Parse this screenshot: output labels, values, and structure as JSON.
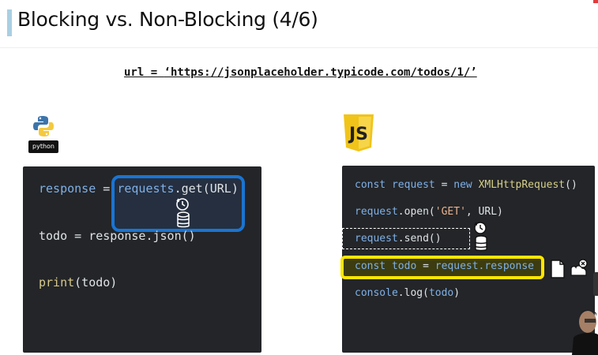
{
  "slide": {
    "title": "Blocking vs. Non-Blocking (4/6)",
    "url_prefix": "url = ",
    "url_value": "‘https://jsonplaceholder.typicode.com/todos/1/’"
  },
  "python_logo": {
    "label": "python",
    "icon": "python-logo-icon"
  },
  "js_logo": {
    "label": "JS",
    "icon": "javascript-logo-icon"
  },
  "python_code": {
    "line1_var": "response",
    "line1_eq": " = ",
    "line1_obj": "requests",
    "line1_call": ".get(URL)",
    "line2": "todo = response.json()",
    "line3_fn": "print",
    "line3_args": "(todo)"
  },
  "js_code": {
    "line1_kw": "const",
    "line1_var": "request",
    "line1_eq": " = ",
    "line1_new": "new",
    "line1_class": "XMLHttpRequest",
    "line1_end": "()",
    "line2_obj": "request",
    "line2_call": ".open(",
    "line2_str": "'GET'",
    "line2_end": ", URL)",
    "line3_obj": "request",
    "line3_call": ".send()",
    "line4_kw": "const",
    "line4_var": "todo",
    "line4_eq": " = ",
    "line4_val": "request.response",
    "line5_obj": "console",
    "line5_call": ".log(",
    "line5_arg": "todo",
    "line5_end": ")"
  },
  "icons": [
    "clock-icon",
    "database-icon",
    "document-icon",
    "cloud-error-icon"
  ],
  "colors": {
    "highlight_blue": "#1a74d2",
    "highlight_yellow": "#ffe600",
    "panel_bg": "#232528"
  }
}
